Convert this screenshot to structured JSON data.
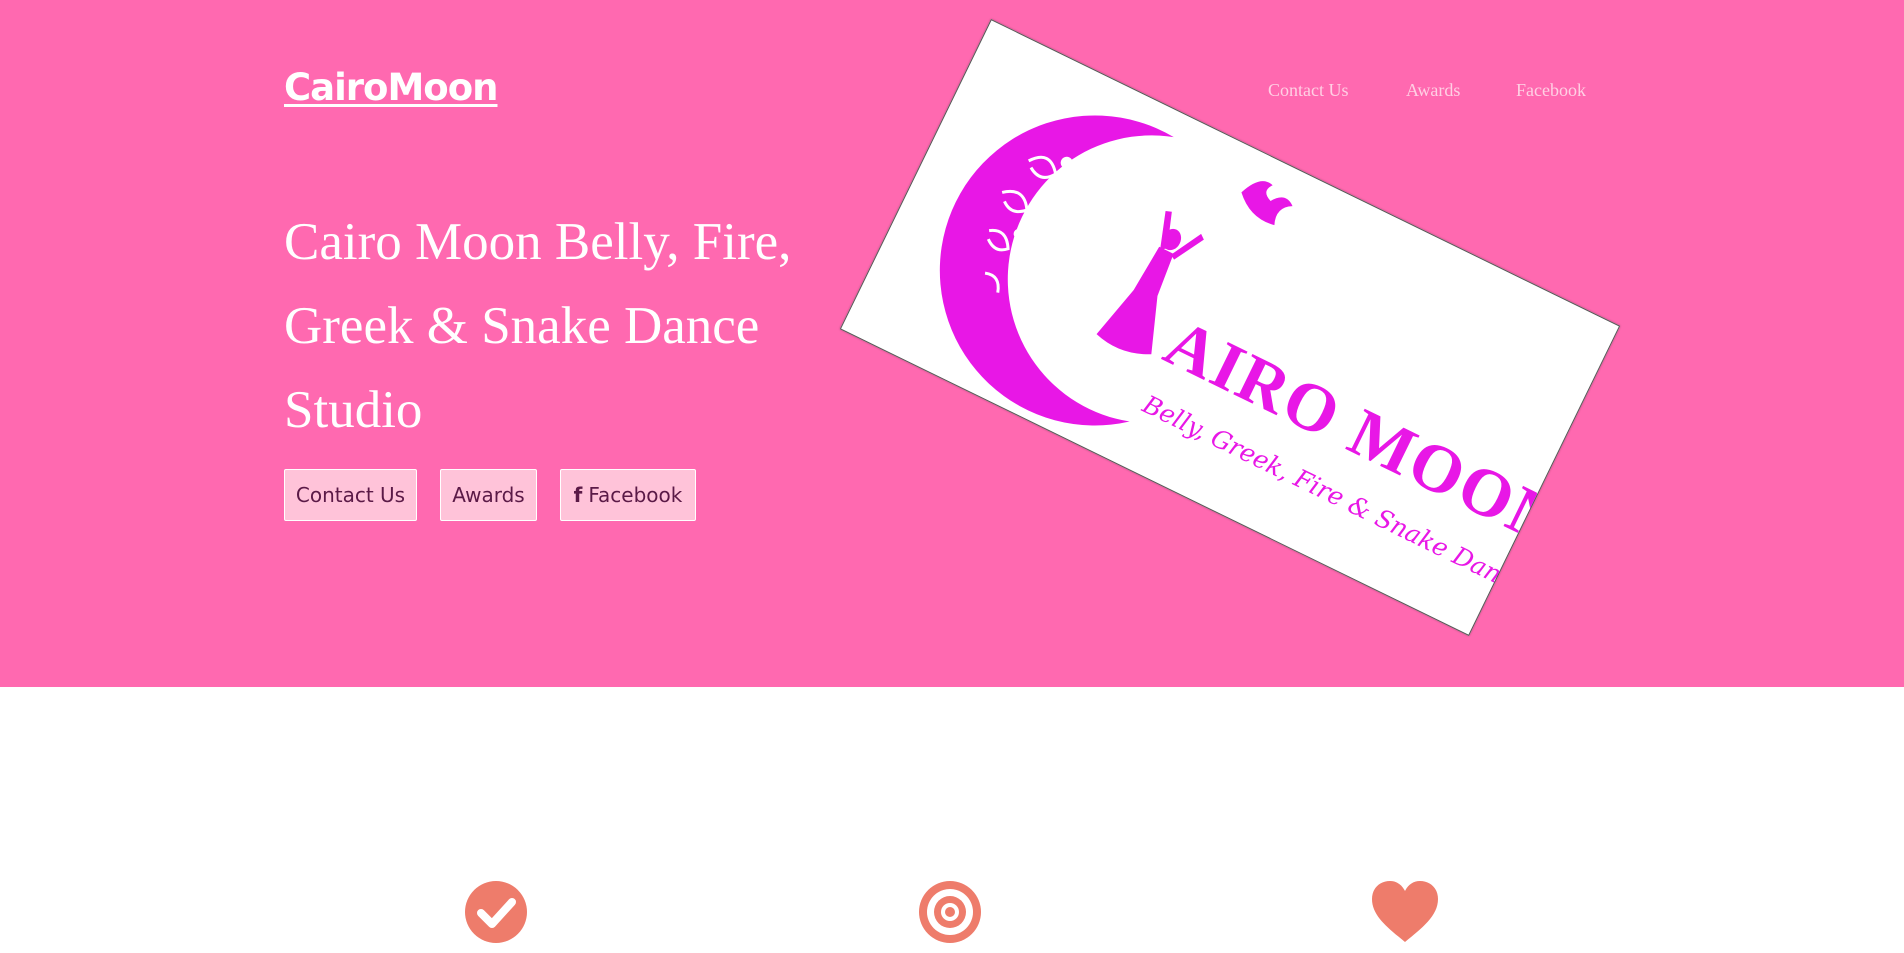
{
  "brand": {
    "name": "CairoMoon"
  },
  "topnav": {
    "items": [
      {
        "label": "Contact Us"
      },
      {
        "label": "Awards"
      },
      {
        "label": "Facebook"
      }
    ]
  },
  "hero": {
    "headline": "Cairo Moon Belly, Fire, Greek & Snake Dance Studio",
    "buttons": [
      {
        "label": "Contact Us"
      },
      {
        "label": "Awards"
      },
      {
        "label": "Facebook",
        "icon": "facebook-icon"
      }
    ],
    "logo": {
      "word": "AIRO MOON",
      "tagline": "Belly, Greek, Fire & Snake Dancing"
    }
  },
  "features": {
    "icons": [
      "check-circle-icon",
      "target-icon",
      "heart-icon"
    ]
  },
  "colors": {
    "hero_bg": "#ff69b0",
    "button_bg": "#ffc3d9",
    "button_text": "#5b1a47",
    "logo_magenta": "#e817e6",
    "icon_salmon": "#ee7c6b"
  }
}
